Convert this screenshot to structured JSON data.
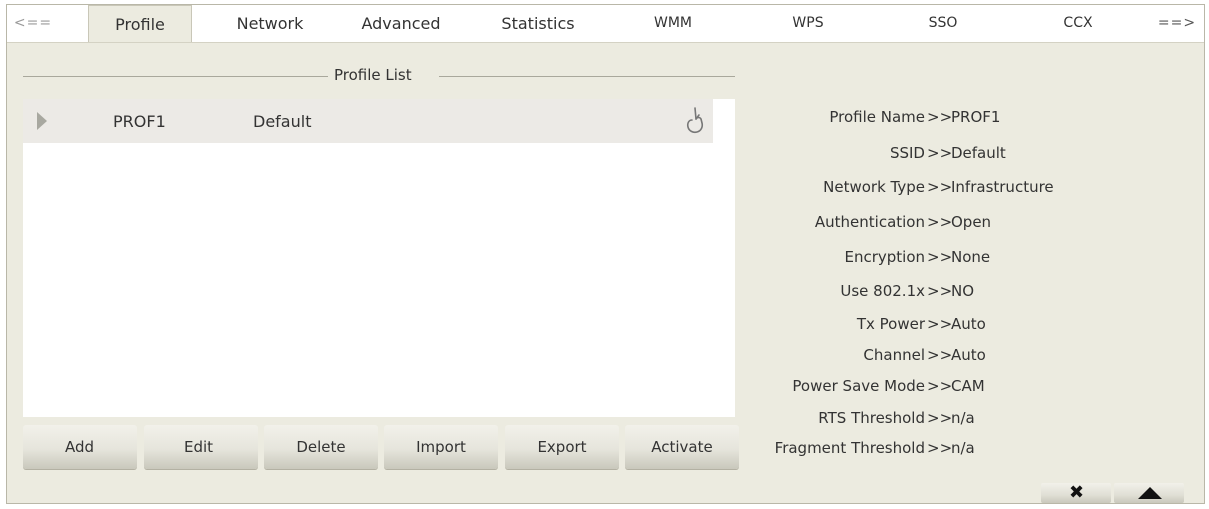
{
  "tabs": {
    "prev_label": "<==",
    "next_label": "==>",
    "items": [
      {
        "label": "Profile"
      },
      {
        "label": "Network"
      },
      {
        "label": "Advanced"
      },
      {
        "label": "Statistics"
      },
      {
        "label": "WMM"
      },
      {
        "label": "WPS"
      },
      {
        "label": "SSO"
      },
      {
        "label": "CCX"
      }
    ],
    "active": "Profile"
  },
  "profile_list": {
    "title": "Profile List",
    "rows": [
      {
        "name": "PROF1",
        "ssid": "Default",
        "icon": "hand-pointer-icon"
      }
    ]
  },
  "buttons": {
    "add": "Add",
    "edit": "Edit",
    "delete": "Delete",
    "import": "Import",
    "export": "Export",
    "activate": "Activate"
  },
  "details": {
    "separator": ">>",
    "items": [
      {
        "label": "Profile Name",
        "value": "PROF1"
      },
      {
        "label": "SSID",
        "value": "Default"
      },
      {
        "label": "Network Type",
        "value": "Infrastructure"
      },
      {
        "label": "Authentication",
        "value": "Open"
      },
      {
        "label": "Encryption",
        "value": "None"
      },
      {
        "label": "Use 802.1x",
        "value": "NO"
      },
      {
        "label": "Tx Power",
        "value": "Auto"
      },
      {
        "label": "Channel",
        "value": "Auto"
      },
      {
        "label": "Power Save Mode",
        "value": "CAM"
      },
      {
        "label": "RTS Threshold",
        "value": "n/a"
      },
      {
        "label": "Fragment Threshold",
        "value": "n/a"
      }
    ]
  },
  "controls": {
    "close_icon": "close-icon",
    "collapse_icon": "triangle-up-icon"
  },
  "colors": {
    "panel_background": "#ecebe0",
    "selected_row": "#eceae6"
  }
}
